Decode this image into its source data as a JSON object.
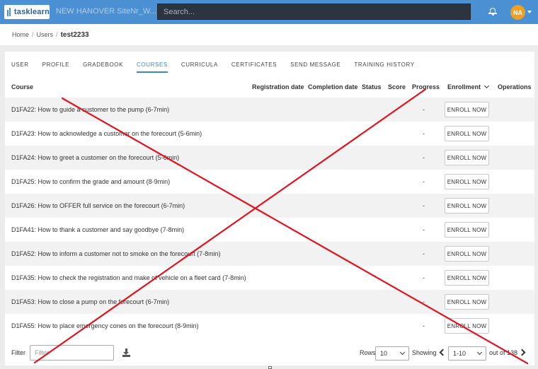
{
  "header": {
    "logo_text": "tasklearn",
    "site_name": "NEW HANOVER SiteNr_W...",
    "search_placeholder": "Search...",
    "avatar_initials": "NA"
  },
  "breadcrumb": {
    "items": [
      "Home",
      "Users"
    ],
    "current": "test2233"
  },
  "tabs": [
    {
      "label": "USER"
    },
    {
      "label": "PROFILE"
    },
    {
      "label": "GRADEBOOK"
    },
    {
      "label": "COURSES",
      "active": true
    },
    {
      "label": "CURRICULA"
    },
    {
      "label": "CERTIFICATES"
    },
    {
      "label": "SEND MESSAGE"
    },
    {
      "label": "TRAINING HISTORY"
    }
  ],
  "table": {
    "columns": {
      "course": "Course",
      "registration": "Registration date",
      "completion": "Completion date",
      "status": "Status",
      "score": "Score",
      "progress": "Progress",
      "enrollment": "Enrollment",
      "operations": "Operations"
    },
    "enroll_label": "ENROLL NOW",
    "rows": [
      {
        "course": "D1FA22: How to guide a customer to the pump (6-7min)",
        "progress": "-"
      },
      {
        "course": "D1FA23: How to acknowledge a customer on the forecourt (5-6min)",
        "progress": "-"
      },
      {
        "course": "D1FA24: How to greet a customer on the forecourt (5-6min)",
        "progress": "-"
      },
      {
        "course": "D1FA25: How to confirm the grade and amount (8-9min)",
        "progress": "-"
      },
      {
        "course": "D1FA26: How to OFFER full service on the forecourt (6-7min)",
        "progress": "-"
      },
      {
        "course": "D1FA41: How to thank a customer and say goodbye (7-8min)",
        "progress": "-"
      },
      {
        "course": "D1FA52: How to inform a customer not to smoke on the forecourt (7-8min)",
        "progress": "-"
      },
      {
        "course": "D1FA35: How to check the registration and make of vehicle on a fleet card (7-8min)",
        "progress": "-"
      },
      {
        "course": "D1FA53: How to close a pump on the forecourt (6-7min)",
        "progress": "-"
      },
      {
        "course": "D1FA55: How to place emergency cones on the forecourt (8-9min)",
        "progress": "-"
      }
    ]
  },
  "footer": {
    "filter_label": "Filter",
    "filter_placeholder": "Filter",
    "rows_label": "Rows",
    "rows_value": "10",
    "showing_label": "Showing",
    "range_value": "1-10",
    "out_of": "out of 138"
  },
  "colors": {
    "header_bg": "#4a90d2",
    "search_bg": "#2c3440",
    "accent": "#3f86c9",
    "avatar_bg": "#f0a020",
    "cross_line": "#e0141e"
  }
}
